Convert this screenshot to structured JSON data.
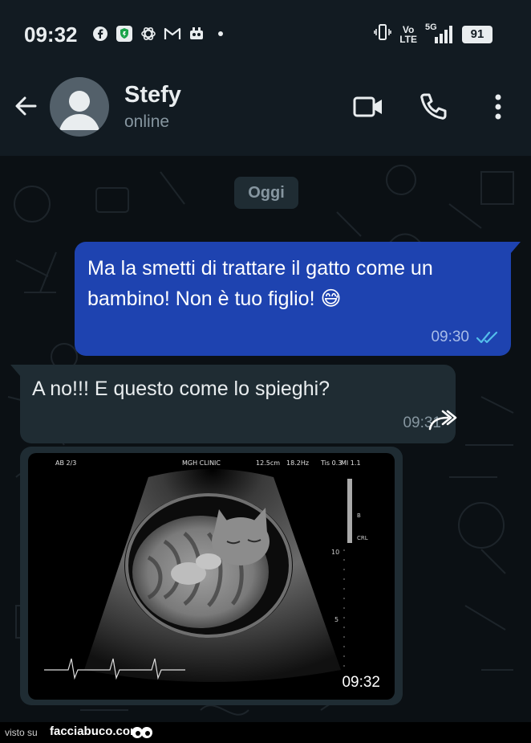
{
  "status_bar": {
    "time": "09:32",
    "left_icons": [
      "facebook-icon",
      "shield-icon",
      "chatgpt-icon",
      "gmail-icon",
      "bot-icon",
      "dot-icon"
    ],
    "network_1": "Vo",
    "network_2": "LTE",
    "network_type": "5G",
    "battery": "91"
  },
  "header": {
    "contact_name": "Stefy",
    "contact_status": "online"
  },
  "chat": {
    "date_chip": "Oggi",
    "messages": [
      {
        "direction": "outgoing",
        "text": "Ma la smetti di trattare il gatto come un bambino! Non è tuo figlio! 😅",
        "time": "09:30",
        "status": "read"
      },
      {
        "direction": "incoming",
        "text": "A no!!! E questo come lo spieghi?",
        "time": "09:31"
      },
      {
        "direction": "incoming",
        "type": "image",
        "time": "09:32",
        "image_labels": {
          "ab": "AB 2/3",
          "clinic": "MGH CLINIC",
          "depth": "12.5cm",
          "freq": "18.2Hz",
          "tis": "Tis 0.3",
          "mi": "MI 1.1",
          "scale_top": "B",
          "scale_mid": "CRL",
          "scale_10": "10",
          "scale_5": "5"
        }
      }
    ]
  },
  "footer": {
    "visto_su": "visto su",
    "brand": "facciabuco.com"
  },
  "colors": {
    "outgoing_bubble": "#1e43b0",
    "incoming_bubble": "#1f2c33",
    "background": "#0b1014",
    "header": "#121b22"
  }
}
